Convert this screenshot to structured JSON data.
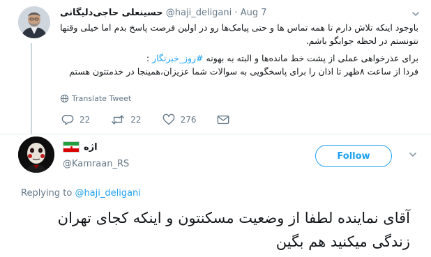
{
  "tweet1": {
    "display_name": "حسینعلی حاجی‌دلیگانی",
    "handle": "@haji_deligani",
    "separator": "·",
    "date": "Aug 7",
    "body_line1": "باوجود اینکه تلاش دارم تا همه تماس ها و حتی پیامک‌ها رو در اولین فرصت پاسخ بدم اما خیلی وقتها نتونستم در لحظه جوابگو باشم.",
    "body_line2_prefix": "برای عذرخواهی عملی از پشت خط مانده‌ها و البته به بهونه",
    "hashtag": "#روز_خبرنگار",
    "body_line2_suffix": ":",
    "body_line3": "فردا از ساعت ۸ظهر تا اذان را برای پاسخگویی به سوالات شما عزیزان،همینجا در خدمتتون هستم",
    "translate_label": "Translate Tweet",
    "reply_count": "22",
    "retweet_count": "22",
    "like_count": "276"
  },
  "tweet2": {
    "display_name": "اژه",
    "handle": "@Kamraan_RS",
    "follow_label": "Follow",
    "replying_prefix": "Replying to",
    "replying_handle": "@haji_deligani",
    "body": "آقای نماینده لطفا از وضعیت مسکنتون و اینکه کجای تهران زندگی میکنید هم بگین"
  },
  "icons": {
    "translate": "globe-icon",
    "reply": "reply-icon",
    "retweet": "retweet-icon",
    "like": "heart-icon",
    "message": "envelope-icon",
    "caret": "chevron-down-icon",
    "flag": "iran-flag-icon"
  },
  "colors": {
    "accent": "#1da1f2",
    "muted": "#657786",
    "divider": "#e6ecf0",
    "text": "#14171a",
    "flag_green": "#239f40",
    "flag_white": "#ffffff",
    "flag_red": "#da0000"
  }
}
